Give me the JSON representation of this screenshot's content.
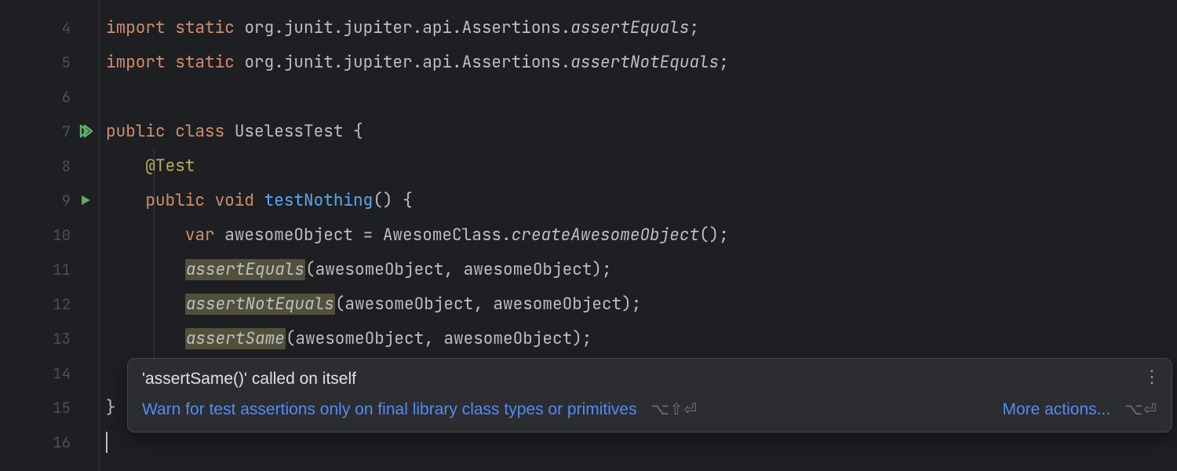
{
  "gutter": {
    "lines": [
      "4",
      "5",
      "6",
      "7",
      "8",
      "9",
      "10",
      "11",
      "12",
      "13",
      "14",
      "15",
      "16"
    ],
    "runnable": {
      "7": "double",
      "9": "single"
    }
  },
  "code": {
    "l4": {
      "import": "import",
      "static": "static",
      "pkg": "org.junit.jupiter.api.Assertions.",
      "member": "assertEquals",
      "semi": ";"
    },
    "l5": {
      "import": "import",
      "static": "static",
      "pkg": "org.junit.jupiter.api.Assertions.",
      "member": "assertNotEquals",
      "semi": ";"
    },
    "l7": {
      "pub": "public",
      "cls": "class",
      "name": "UselessTest",
      "brace": " {"
    },
    "l8": {
      "ann": "@Test"
    },
    "l9": {
      "pub": "public",
      "void": "void",
      "name": "testNothing",
      "rest": "() {"
    },
    "l10": {
      "var": "var",
      "id": " awesomeObject ",
      "eq": "= ",
      "cls": "AwesomeClass",
      "dot": ".",
      "call": "createAwesomeObject",
      "rest": "();"
    },
    "l11": {
      "m": "assertEquals",
      "args": "(awesomeObject, awesomeObject);"
    },
    "l12": {
      "m": "assertNotEquals",
      "args": "(awesomeObject, awesomeObject);"
    },
    "l13": {
      "m": "assertSame",
      "args": "(awesomeObject, awesomeObject);"
    },
    "l14": {
      "brace": "}"
    },
    "l15": {
      "brace": "}"
    }
  },
  "popup": {
    "title": "'assertSame()' called on itself",
    "fix_link": "Warn for test assertions only on final library class types or primitives",
    "fix_shortcut": "⌥⇧⏎",
    "more_link": "More actions...",
    "more_shortcut": "⌥⏎"
  }
}
